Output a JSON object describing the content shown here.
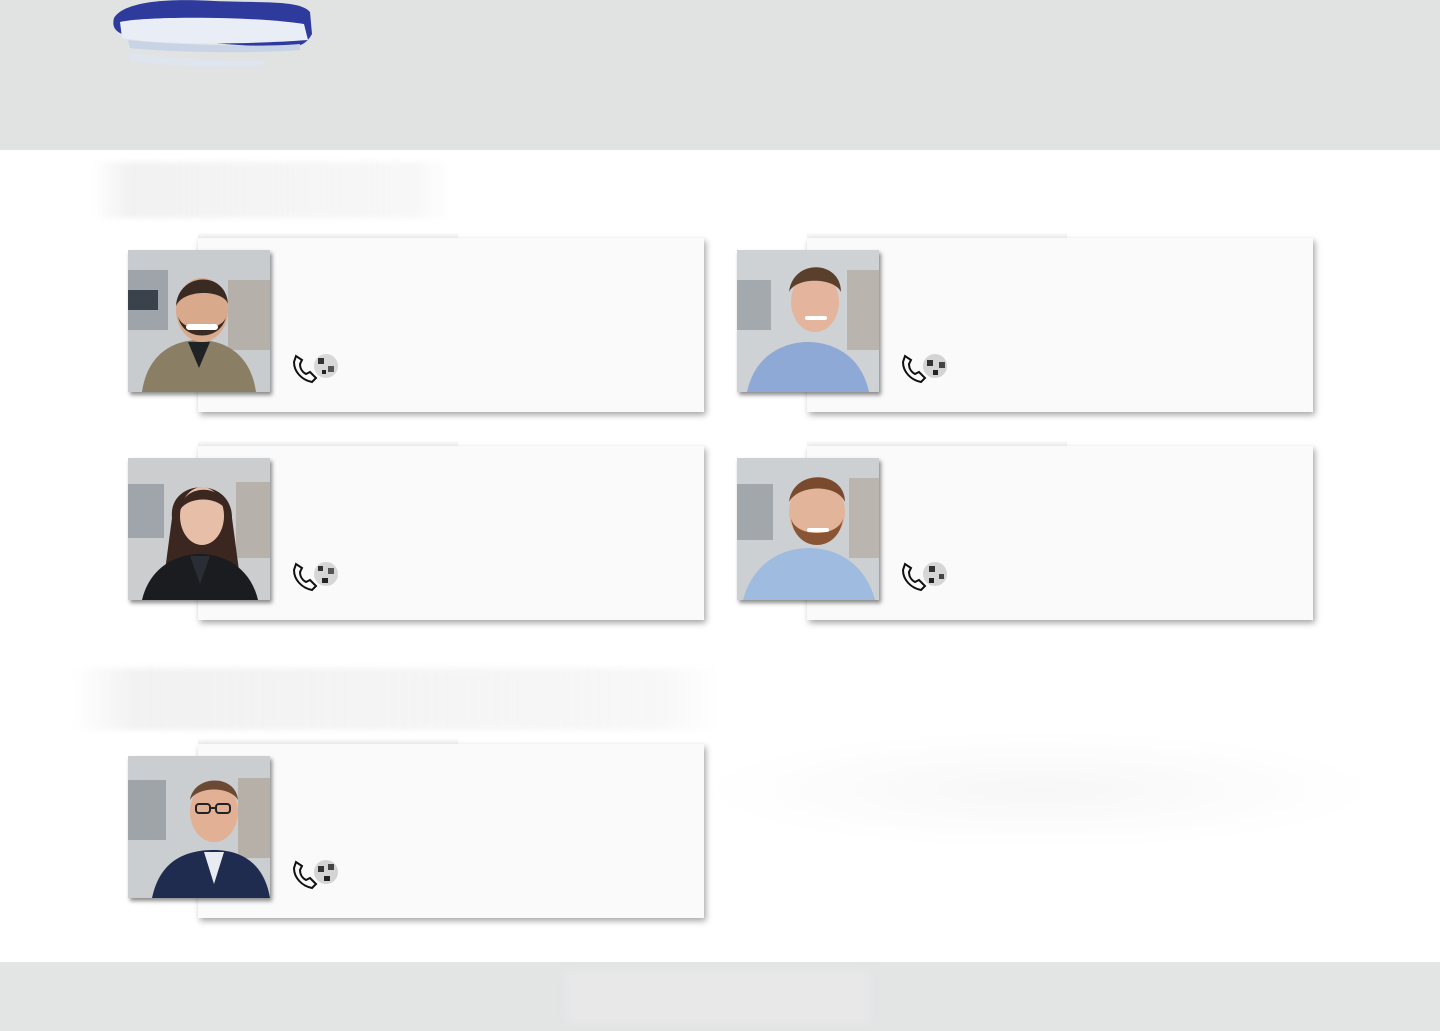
{
  "header": {
    "logo_icon": "brand-logo"
  },
  "sections": [
    {
      "heading": ""
    },
    {
      "heading": ""
    }
  ],
  "contacts": [
    {
      "photo_icon": "person-photo-man-beard-blazer",
      "contact_icon": "phone-icon"
    },
    {
      "photo_icon": "person-photo-man-blue-shirt",
      "contact_icon": "phone-icon"
    },
    {
      "photo_icon": "person-photo-woman-black-blazer",
      "contact_icon": "phone-icon"
    },
    {
      "photo_icon": "person-photo-man-red-beard",
      "contact_icon": "phone-icon"
    },
    {
      "photo_icon": "person-photo-man-glasses-suit",
      "contact_icon": "phone-icon"
    }
  ],
  "footer": {
    "text": ""
  },
  "colors": {
    "header_bg": "#e1e2e2",
    "footer_bg": "#e3e4e4",
    "logo_blue": "#2e3a9c",
    "card_bg": "#fafafa"
  }
}
